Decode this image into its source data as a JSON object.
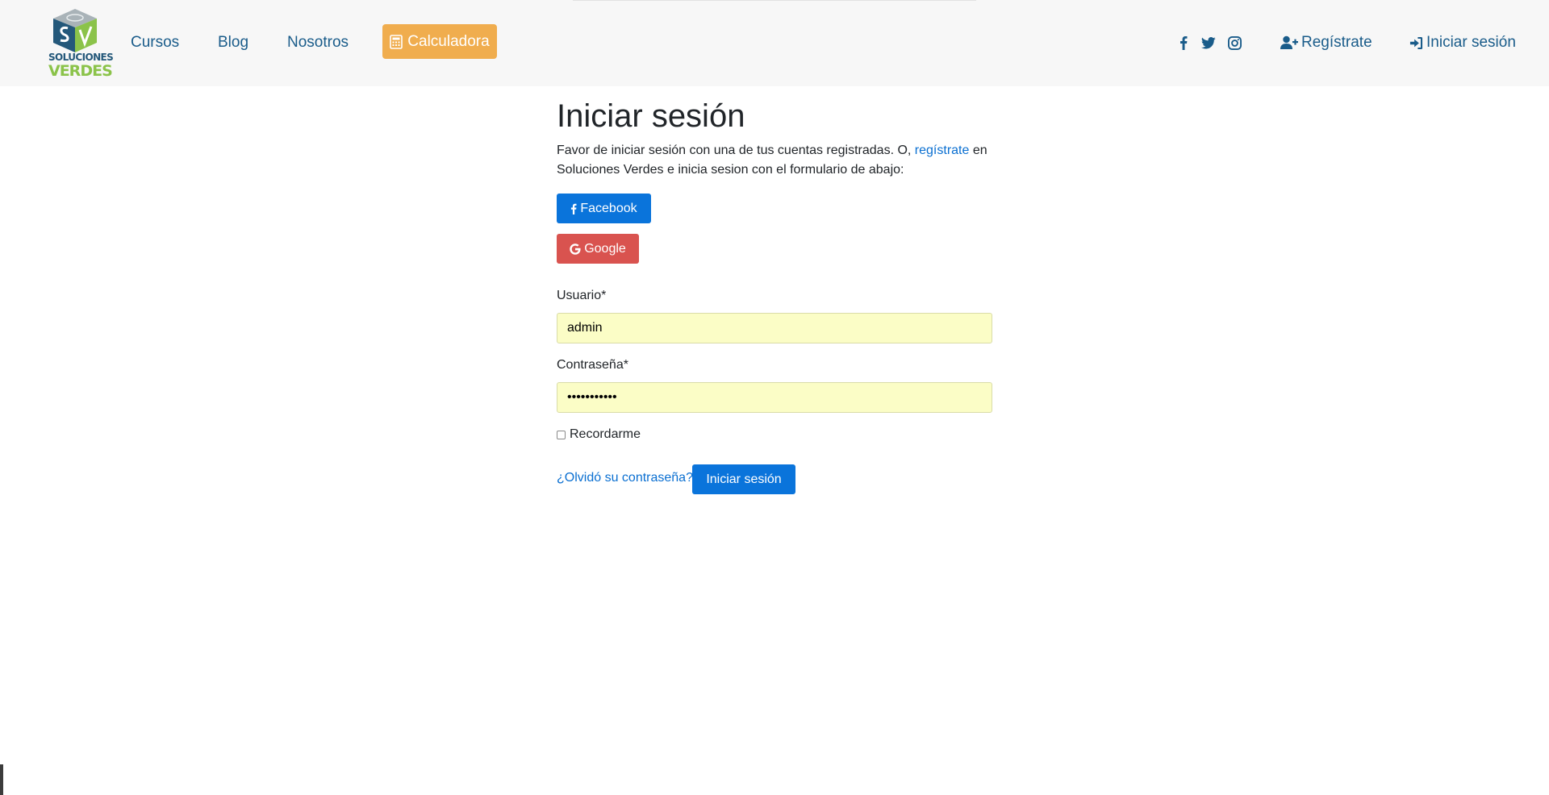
{
  "brand": {
    "logo_line1": "SOLUCIONES",
    "logo_line2": "VERDES",
    "colors": {
      "navy": "#24587a",
      "green": "#8bc34a"
    }
  },
  "nav": {
    "links": [
      "Cursos",
      "Blog",
      "Nosotros"
    ],
    "calculator_label": "Calculadora",
    "calculator_icon": "calculator-icon",
    "social_icons": [
      "facebook-icon",
      "twitter-icon",
      "instagram-icon"
    ],
    "register_label": "Regístrate",
    "register_icon": "user-plus-icon",
    "login_label": "Iniciar sesión",
    "login_icon": "sign-in-icon"
  },
  "page": {
    "title": "Iniciar sesión",
    "intro_before": "Favor de iniciar sesión con una de tus cuentas registradas. O, ",
    "intro_link": "regístrate",
    "intro_after": " en Soluciones Verdes e inicia sesion con el formulario de abajo:",
    "facebook_label": "Facebook",
    "google_label": "Google"
  },
  "form": {
    "username_label": "Usuario*",
    "username_value": "admin",
    "password_label": "Contraseña*",
    "password_value": "•••••••••••",
    "remember_label": "Recordarme",
    "forgot_label": "¿Olvidó su contraseña?",
    "submit_label": "Iniciar sesión"
  },
  "colors": {
    "nav_link": "#1a5c8a",
    "accent_orange": "#f0ad4e",
    "primary_blue": "#0a74db",
    "google_red": "#d9534f",
    "autofill_yellow": "#fbfdc6"
  }
}
